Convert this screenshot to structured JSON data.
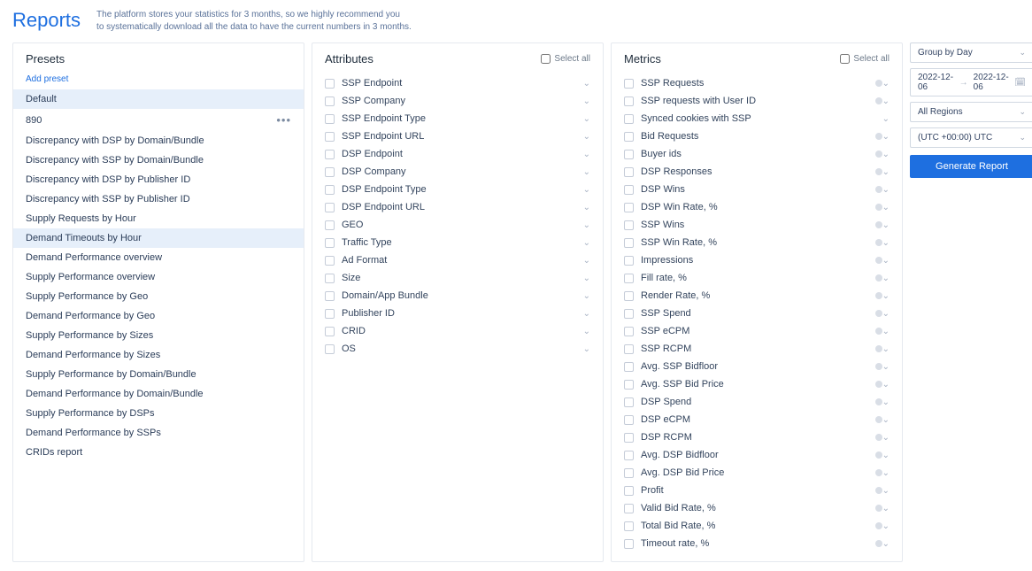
{
  "header": {
    "title": "Reports",
    "desc_l1": "The platform stores your statistics for 3 months, so we highly recommend you",
    "desc_l2": "to systematically download all the data to have the current numbers in 3 months."
  },
  "presets": {
    "title": "Presets",
    "add_label": "Add preset",
    "items": [
      {
        "label": "Default",
        "selected": true
      },
      {
        "label": "890",
        "more": true
      },
      {
        "label": "Discrepancy with DSP by Domain/Bundle"
      },
      {
        "label": "Discrepancy with SSP by Domain/Bundle"
      },
      {
        "label": "Discrepancy with DSP by Publisher ID"
      },
      {
        "label": "Discrepancy with SSP by Publisher ID"
      },
      {
        "label": "Supply Requests by Hour"
      },
      {
        "label": "Demand Timeouts by Hour",
        "highlight": true
      },
      {
        "label": "Demand Performance overview"
      },
      {
        "label": "Supply Performance overview"
      },
      {
        "label": "Supply Performance by Geo"
      },
      {
        "label": "Demand Performance by Geo"
      },
      {
        "label": "Supply Performance by Sizes"
      },
      {
        "label": "Demand Performance by Sizes"
      },
      {
        "label": "Supply Performance by Domain/Bundle"
      },
      {
        "label": "Demand Performance by Domain/Bundle"
      },
      {
        "label": "Supply Performance by DSPs"
      },
      {
        "label": "Demand Performance by SSPs"
      },
      {
        "label": "CRIDs report"
      }
    ]
  },
  "attributes": {
    "title": "Attributes",
    "select_all": "Select all",
    "items": [
      {
        "label": "SSP Endpoint"
      },
      {
        "label": "SSP Company"
      },
      {
        "label": "SSP Endpoint Type"
      },
      {
        "label": "SSP Endpoint URL"
      },
      {
        "label": "DSP Endpoint"
      },
      {
        "label": "DSP Company"
      },
      {
        "label": "DSP Endpoint Type"
      },
      {
        "label": "DSP Endpoint URL"
      },
      {
        "label": "GEO"
      },
      {
        "label": "Traffic Type"
      },
      {
        "label": "Ad Format"
      },
      {
        "label": "Size"
      },
      {
        "label": "Domain/App Bundle"
      },
      {
        "label": "Publisher ID"
      },
      {
        "label": "CRID"
      },
      {
        "label": "OS"
      }
    ]
  },
  "metrics": {
    "title": "Metrics",
    "select_all": "Select all",
    "items": [
      {
        "label": "SSP Requests",
        "info": true
      },
      {
        "label": "SSP requests with User ID",
        "info": true
      },
      {
        "label": "Synced cookies with SSP"
      },
      {
        "label": "Bid Requests",
        "info": true
      },
      {
        "label": "Buyer ids",
        "info": true
      },
      {
        "label": "DSP Responses",
        "info": true
      },
      {
        "label": "DSP Wins",
        "info": true
      },
      {
        "label": "DSP Win Rate, %",
        "info": true
      },
      {
        "label": "SSP Wins",
        "info": true
      },
      {
        "label": "SSP Win Rate, %",
        "info": true
      },
      {
        "label": "Impressions",
        "info": true
      },
      {
        "label": "Fill rate, %",
        "info": true
      },
      {
        "label": "Render Rate, %",
        "info": true
      },
      {
        "label": "SSP Spend",
        "info": true
      },
      {
        "label": "SSP eCPM",
        "info": true
      },
      {
        "label": "SSP RCPM",
        "info": true
      },
      {
        "label": "Avg. SSP Bidfloor",
        "info": true
      },
      {
        "label": "Avg. SSP Bid Price",
        "info": true
      },
      {
        "label": "DSP Spend",
        "info": true
      },
      {
        "label": "DSP eCPM",
        "info": true
      },
      {
        "label": "DSP RCPM",
        "info": true
      },
      {
        "label": "Avg. DSP Bidfloor",
        "info": true
      },
      {
        "label": "Avg. DSP Bid Price",
        "info": true
      },
      {
        "label": "Profit",
        "info": true
      },
      {
        "label": "Valid Bid Rate, %",
        "info": true
      },
      {
        "label": "Total Bid Rate, %",
        "info": true
      },
      {
        "label": "Timeout rate, %",
        "info": true
      }
    ]
  },
  "controls": {
    "group_by": "Group by Day",
    "date_from": "2022-12-06",
    "date_to": "2022-12-06",
    "region": "All Regions",
    "timezone": "(UTC +00:00) UTC",
    "generate": "Generate Report"
  }
}
